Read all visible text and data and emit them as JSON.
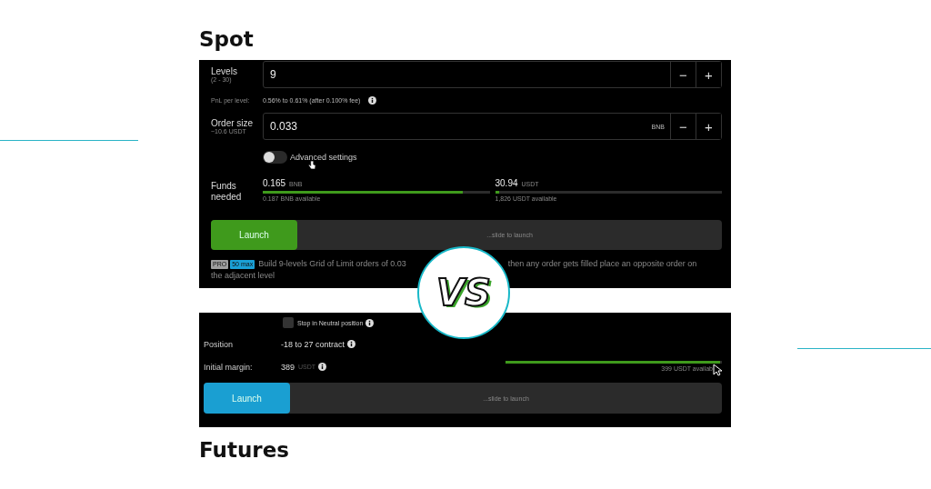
{
  "spot": {
    "heading": "Spot",
    "levels": {
      "label": "Levels",
      "hint": "(2 - 30)",
      "value": "9",
      "minus": "−",
      "plus": "+"
    },
    "pnl": {
      "label": "PnL per level:",
      "value": "0.56% to 0.61% (after 0.100% fee)"
    },
    "order_size": {
      "label": "Order size",
      "hint": "~10.6 USDT",
      "value": "0.033",
      "unit": "BNB",
      "minus": "−",
      "plus": "+"
    },
    "advanced": {
      "label": "Advanced settings",
      "on": false
    },
    "funds": {
      "label": "Funds needed",
      "items": [
        {
          "amount": "0.165",
          "unit": "BNB",
          "available": "0.187 BNB available",
          "level": 0.88
        },
        {
          "amount": "30.94",
          "unit": "USDT",
          "available": "1,826 USDT available",
          "level": 0.02
        }
      ]
    },
    "launch": {
      "button": "Launch",
      "track": "...slide to launch",
      "color": "#3f9a1c"
    },
    "badges": [
      {
        "text": "PRO",
        "color": "#9e9e9e"
      },
      {
        "text": "50 max",
        "color": "#1aa0d6"
      }
    ],
    "description": [
      "Build 9-levels Grid of Limit orders of 0.03",
      "then any order gets filled place an opposite order on",
      "the adjacent level"
    ]
  },
  "vs": "VS",
  "futures": {
    "heading": "Futures",
    "stop_neutral": {
      "label": "Stop in Neutral position",
      "checked": false
    },
    "position": {
      "label": "Position",
      "value": "-18 to 27 contract"
    },
    "margin": {
      "label": "Initial margin:",
      "value": "389",
      "unit": "USDT",
      "available": "399 USDT availab",
      "level": 0.99
    },
    "launch": {
      "button": "Launch",
      "track": "...slide to launch",
      "color": "#1a9fd2"
    }
  }
}
